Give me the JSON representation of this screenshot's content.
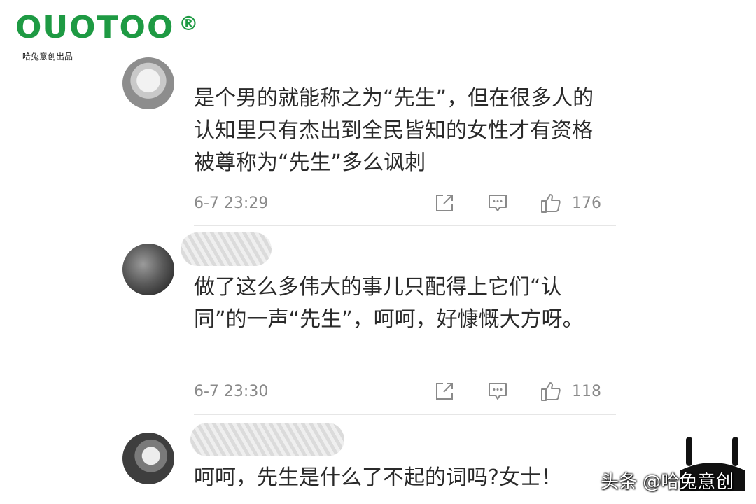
{
  "brand": {
    "logo": "OUOTOO",
    "registered": "®",
    "subtitle": "哈兔意创出品"
  },
  "comments": [
    {
      "text": "是个男的就能称之为“先生”，但在很多人的认知里只有杰出到全民皆知的女性才有资格被尊称为“先生”多么讽刺",
      "time": "6-7 23:29",
      "likes": "176"
    },
    {
      "text": "做了这么多伟大的事儿只配得上它们“认同”的一声“先生”，呵呵，好慷慨大方呀。",
      "time": "6-7 23:30",
      "likes": "118"
    },
    {
      "text": "呵呵，先生是什么了不起的词吗?女士！"
    }
  ],
  "watermark": "头条 @哈兔意创",
  "icons": {
    "share": "share-icon",
    "reply": "comment-icon",
    "like": "thumbs-up-icon"
  }
}
